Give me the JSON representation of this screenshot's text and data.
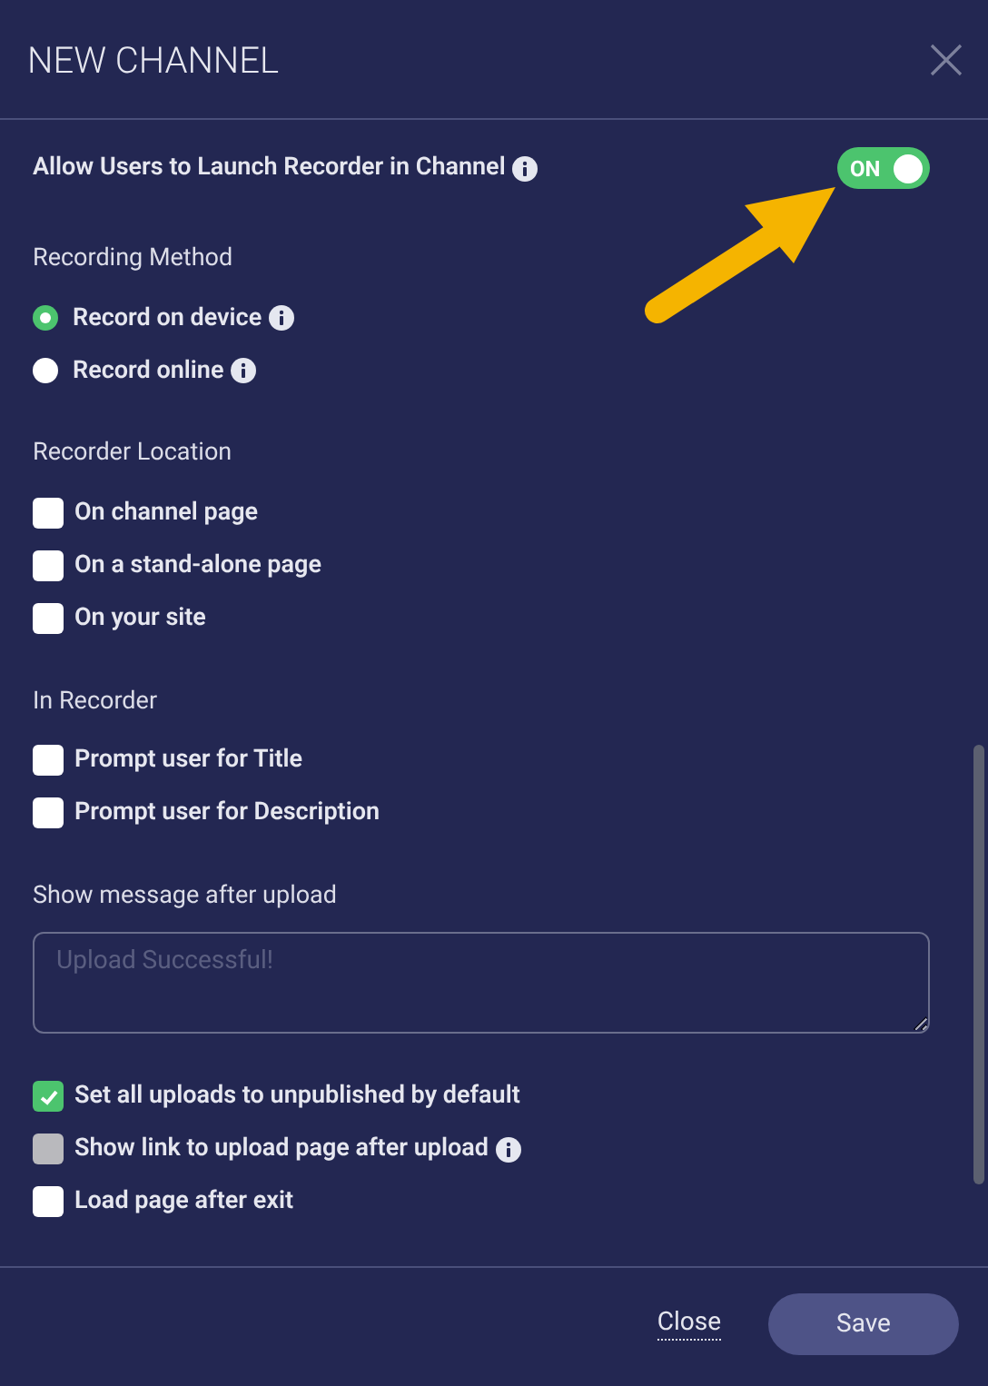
{
  "dialog": {
    "title": "NEW CHANNEL"
  },
  "launch_toggle": {
    "label": "Allow Users to Launch Recorder in Channel",
    "info": true,
    "on": true,
    "state_text": "ON"
  },
  "sections": [
    {
      "title": "Recording Method",
      "kind": "radio",
      "options": [
        {
          "label": "Record on device",
          "info": true,
          "selected": true
        },
        {
          "label": "Record online",
          "info": true,
          "selected": false
        }
      ]
    },
    {
      "title": "Recorder Location",
      "kind": "checkbox",
      "options": [
        {
          "label": "On channel page",
          "info": false,
          "checked": false
        },
        {
          "label": "On a stand-alone page",
          "info": false,
          "checked": false
        },
        {
          "label": "On your site",
          "info": false,
          "checked": false
        }
      ]
    },
    {
      "title": "In Recorder",
      "kind": "checkbox",
      "options": [
        {
          "label": "Prompt user for Title",
          "info": false,
          "checked": false
        },
        {
          "label": "Prompt user for Description",
          "info": false,
          "checked": false
        }
      ]
    }
  ],
  "message": {
    "label": "Show message after upload",
    "placeholder": "Upload Successful!"
  },
  "upload_options": [
    {
      "label": "Set all uploads to unpublished by default",
      "info": false,
      "checked": true,
      "disabled": false
    },
    {
      "label": "Show link to upload page after upload",
      "info": true,
      "checked": false,
      "disabled": true
    },
    {
      "label": "Load page after exit",
      "info": false,
      "checked": false,
      "disabled": false
    }
  ],
  "footer": {
    "close": "Close",
    "save": "Save"
  }
}
